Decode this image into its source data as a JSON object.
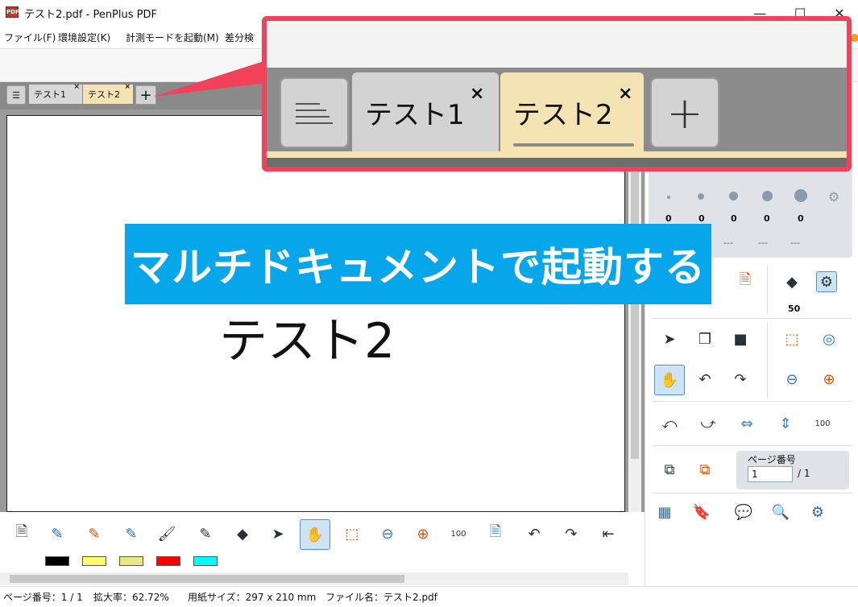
{
  "window": {
    "title": "テスト2.pdf - PenPlus PDF",
    "app_icon": "pdf-icon",
    "minimize": "—",
    "maximize": "☐",
    "close": "✕"
  },
  "menu": [
    "ファイル(F)",
    "環境設定(K)",
    "計測モードを起動(M)",
    "差分検"
  ],
  "tabs": {
    "list_button_icon": "list-icon",
    "items": [
      {
        "label": "テスト1",
        "close": "×",
        "active": false
      },
      {
        "label": "テスト2",
        "close": "×",
        "active": true
      }
    ],
    "add_label": "+"
  },
  "document": {
    "text": "テスト2"
  },
  "sidebar": {
    "dots": [
      {
        "value": "0"
      },
      {
        "value": "0"
      },
      {
        "value": "0"
      },
      {
        "value": "0"
      },
      {
        "value": "0"
      }
    ],
    "dashes": [
      "---",
      "---",
      "---",
      "---"
    ],
    "eraser_value": "50",
    "page_label": "ページ番号",
    "page_value": "1",
    "page_total": "/ 1"
  },
  "swatches": [
    "#000000",
    "#ffff66",
    "#e8e880",
    "#ff0000",
    "#00ffff"
  ],
  "status": {
    "page": "ページ番号：1 / 1",
    "zoom": "拡大率：62.72%",
    "paper": "用紙サイズ：297 x 210 mm",
    "file": "ファイル名：テスト2.pdf"
  },
  "zoom_inset": {
    "tab1": "テスト1",
    "tab2": "テスト2",
    "close": "×",
    "add": "+"
  },
  "caption": "マルチドキュメントで起動する",
  "colors": {
    "accent_red": "#f2415b",
    "caption_blue": "#07a6ea",
    "active_tab": "#f6e3b3"
  }
}
